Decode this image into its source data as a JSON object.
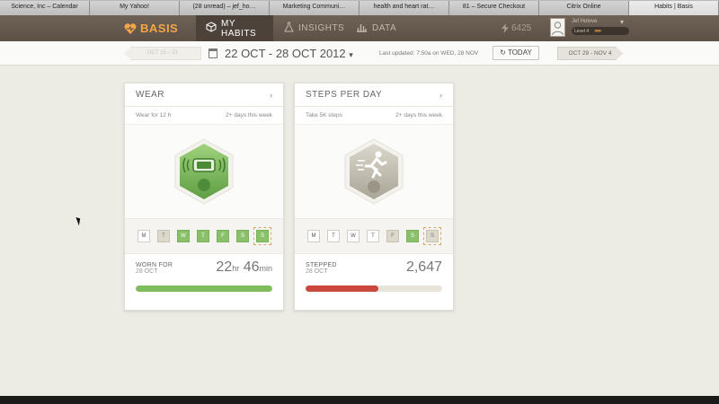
{
  "browser": {
    "tabs": [
      {
        "label": "Science, Inc – Calendar"
      },
      {
        "label": "My Yahoo!"
      },
      {
        "label": "(28 unread) – jef_ho…"
      },
      {
        "label": "Marketing Communi…"
      },
      {
        "label": "health and heart rat…"
      },
      {
        "label": "81 – Secure Checkout"
      },
      {
        "label": "Citrix Online"
      },
      {
        "label": "Habits | Basis"
      }
    ]
  },
  "header": {
    "logo": "BASIS",
    "nav": {
      "my_habits": "MY HABITS",
      "insights": "INSIGHTS",
      "data": "DATA"
    },
    "points": "6425",
    "user": {
      "name": "Jef Holove",
      "level": "Level 4"
    }
  },
  "datebar": {
    "prev_week": "OCT 15 – 21",
    "range": "22 OCT - 28 OCT 2012",
    "updated": "Last updated: 7:50a on WED, 28 NOV",
    "today": "TODAY",
    "next_week": "OCT 29 - NOV 4"
  },
  "cards": [
    {
      "title": "WEAR",
      "goal": "Wear for 12 h",
      "frequency": "2+ days this week",
      "days": [
        "M",
        "T",
        "W",
        "T",
        "F",
        "S",
        "S"
      ],
      "stat_label": "WORN FOR",
      "stat_date": "28 OCT",
      "value_hr": "22",
      "unit_hr": "hr",
      "value_min": "46",
      "unit_min": "min",
      "progress": 1.0,
      "color": "#7fbd5c"
    },
    {
      "title": "STEPS PER DAY",
      "goal": "Take 5K steps",
      "frequency": "2+ days this week",
      "days": [
        "M",
        "T",
        "W",
        "T",
        "F",
        "S",
        "S"
      ],
      "stat_label": "STEPPED",
      "stat_date": "28 OCT",
      "value": "2,647",
      "progress": 0.53,
      "color": "#c9473d"
    }
  ]
}
